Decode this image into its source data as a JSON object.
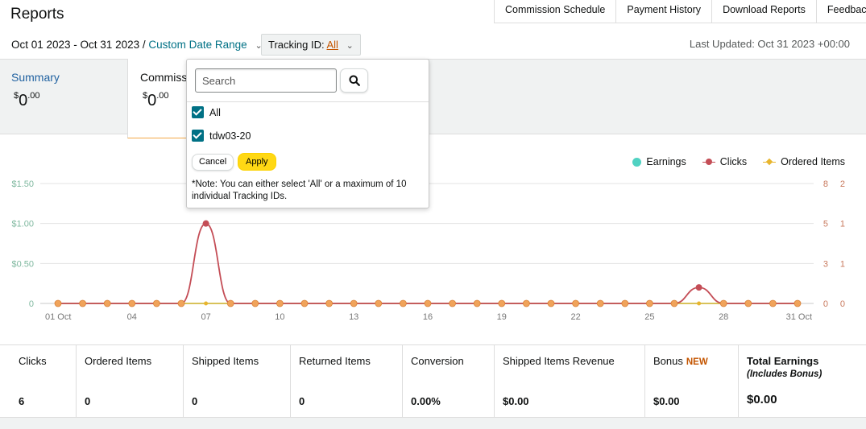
{
  "header": {
    "title": "Reports",
    "tabs": [
      "Commission Schedule",
      "Payment History",
      "Download Reports",
      "Feedback"
    ]
  },
  "filters": {
    "date_range": "Oct 01 2023 - Oct 31 2023 /",
    "custom_range_link": "Custom Date Range",
    "tracking_label": "Tracking ID:",
    "tracking_value": "All",
    "last_updated": "Last Updated: Oct 31 2023 +00:00"
  },
  "summary_cards": {
    "summary": {
      "label": "Summary",
      "value_main": "0",
      "value_cents": ".00",
      "currency": "$"
    },
    "commission": {
      "label": "Commission",
      "value_main": "0",
      "value_cents": ".00",
      "currency": "$"
    }
  },
  "tracking_popover": {
    "search_placeholder": "Search",
    "search_value": "",
    "options": [
      {
        "label": "All",
        "checked": true
      },
      {
        "label": "tdw03-20",
        "checked": true
      }
    ],
    "cancel_label": "Cancel",
    "apply_label": "Apply",
    "note": "*Note: You can either select 'All' or a maximum of 10 individual Tracking IDs."
  },
  "legend": {
    "earnings": "Earnings",
    "clicks": "Clicks",
    "ordered_items": "Ordered Items"
  },
  "colors": {
    "earnings": "#50d2c2",
    "clicks": "#c44d56",
    "ordered": "#e8b52e",
    "link": "#007185",
    "accent": "#c45500"
  },
  "chart_data": {
    "type": "line",
    "x": [
      1,
      2,
      3,
      4,
      5,
      6,
      7,
      8,
      9,
      10,
      11,
      12,
      13,
      14,
      15,
      16,
      17,
      18,
      19,
      20,
      21,
      22,
      23,
      24,
      25,
      26,
      27,
      28,
      29,
      30,
      31
    ],
    "x_tick_labels": [
      {
        "day": 1,
        "label": "01 Oct"
      },
      {
        "day": 4,
        "label": "04"
      },
      {
        "day": 7,
        "label": "07"
      },
      {
        "day": 10,
        "label": "10"
      },
      {
        "day": 13,
        "label": "13"
      },
      {
        "day": 16,
        "label": "16"
      },
      {
        "day": 19,
        "label": "19"
      },
      {
        "day": 22,
        "label": "22"
      },
      {
        "day": 25,
        "label": "25"
      },
      {
        "day": 28,
        "label": "28"
      },
      {
        "day": 31,
        "label": "31 Oct"
      }
    ],
    "y_left_ticks": [
      "0",
      "$0.50",
      "$1.00",
      "$1.50"
    ],
    "y_right_clicks_ticks": [
      "0",
      "3",
      "5",
      "8"
    ],
    "y_right_items_ticks": [
      "0",
      "1",
      "1",
      "2"
    ],
    "series": [
      {
        "name": "Earnings",
        "axis": "left",
        "ylim": [
          0,
          1.5
        ],
        "values": [
          0,
          0,
          0,
          0,
          0,
          0,
          0,
          0,
          0,
          0,
          0,
          0,
          0,
          0,
          0,
          0,
          0,
          0,
          0,
          0,
          0,
          0,
          0,
          0,
          0,
          0,
          0,
          0,
          0,
          0,
          0
        ]
      },
      {
        "name": "Clicks",
        "axis": "right",
        "ylim": [
          0,
          7.5
        ],
        "values": [
          0,
          0,
          0,
          0,
          0,
          0,
          5,
          0,
          0,
          0,
          0,
          0,
          0,
          0,
          0,
          0,
          0,
          0,
          0,
          0,
          0,
          0,
          0,
          0,
          0,
          0,
          1,
          0,
          0,
          0,
          0
        ]
      },
      {
        "name": "Ordered Items",
        "axis": "right",
        "ylim": [
          0,
          2
        ],
        "values": [
          0,
          0,
          0,
          0,
          0,
          0,
          0,
          0,
          0,
          0,
          0,
          0,
          0,
          0,
          0,
          0,
          0,
          0,
          0,
          0,
          0,
          0,
          0,
          0,
          0,
          0,
          0,
          0,
          0,
          0,
          0
        ]
      }
    ]
  },
  "stats": [
    {
      "label": "Clicks",
      "value": "6"
    },
    {
      "label": "Ordered Items",
      "value": "0"
    },
    {
      "label": "Shipped Items",
      "value": "0"
    },
    {
      "label": "Returned Items",
      "value": "0"
    },
    {
      "label": "Conversion",
      "value": "0.00%"
    },
    {
      "label": "Shipped Items Revenue",
      "value": "$0.00"
    },
    {
      "label": "Bonus",
      "badge": "NEW",
      "value": "$0.00"
    },
    {
      "label": "Total Earnings",
      "sublabel": "(Includes Bonus)",
      "value": "$0.00"
    }
  ]
}
